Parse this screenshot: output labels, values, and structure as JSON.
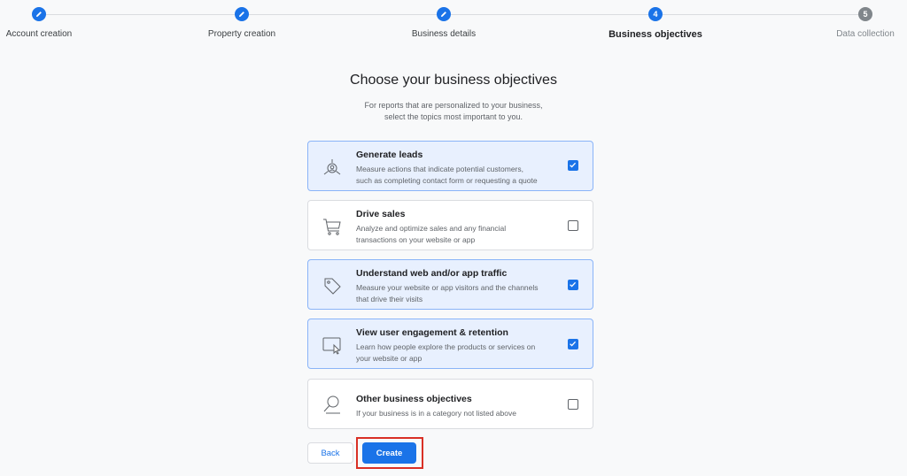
{
  "stepper": {
    "steps": [
      {
        "label": "Account creation",
        "status": "done",
        "icon": "pencil-icon"
      },
      {
        "label": "Property creation",
        "status": "done",
        "icon": "pencil-icon"
      },
      {
        "label": "Business details",
        "status": "done",
        "icon": "pencil-icon"
      },
      {
        "label": "Business objectives",
        "status": "active",
        "number": "4"
      },
      {
        "label": "Data collection",
        "status": "pending",
        "number": "5"
      }
    ]
  },
  "page": {
    "title": "Choose your business objectives",
    "subtitle_line1": "For reports that are personalized to your business,",
    "subtitle_line2": "select the topics most important to you."
  },
  "objectives": [
    {
      "title": "Generate leads",
      "line1": "Measure actions that indicate potential customers,",
      "line2": "such as completing contact form or requesting a quote",
      "checked": true,
      "icon": "leads-target-icon"
    },
    {
      "title": "Drive sales",
      "line1": "Analyze and optimize sales and any financial",
      "line2": "transactions on your website or app",
      "checked": false,
      "icon": "shopping-cart-icon"
    },
    {
      "title": "Understand web and/or app traffic",
      "line1": "Measure your website or app visitors and the channels",
      "line2": "that drive their visits",
      "checked": true,
      "icon": "tag-icon"
    },
    {
      "title": "View user engagement & retention",
      "line1": "Learn how people explore the products or services on",
      "line2": "your website or app",
      "checked": true,
      "icon": "screen-cursor-icon"
    },
    {
      "title": "Other business objectives",
      "line1": "If your business is in a category not listed above",
      "line2": "",
      "checked": false,
      "icon": "magnifier-icon"
    }
  ],
  "buttons": {
    "back_label": "Back",
    "create_label": "Create"
  },
  "colors": {
    "accent": "#1a73e8",
    "selected_bg": "#e8f0fe",
    "highlight": "#d93025"
  }
}
